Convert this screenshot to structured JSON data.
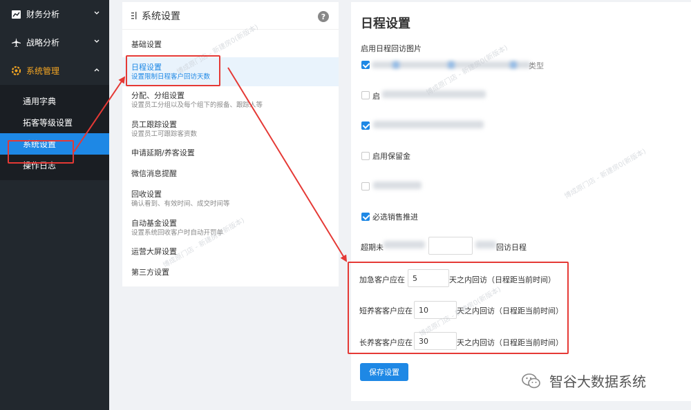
{
  "sidebar": {
    "groups": [
      {
        "label": "财务分析",
        "icon": "chart-icon"
      },
      {
        "label": "战略分析",
        "icon": "plane-icon"
      },
      {
        "label": "系统管理",
        "icon": "settings-icon"
      }
    ],
    "sub_items": [
      {
        "label": "通用字典"
      },
      {
        "label": "拓客等级设置"
      },
      {
        "label": "系统设置"
      },
      {
        "label": "操作日志"
      }
    ],
    "active_sub": "系统设置"
  },
  "mid": {
    "title": "系统设置",
    "items": [
      {
        "title": "基础设置",
        "desc": ""
      },
      {
        "title": "日程设置",
        "desc": "设置限制日程客户回访天数"
      },
      {
        "title": "分配、分组设置",
        "desc": "设置员工分组以及每个组下的报备、跟踪人等"
      },
      {
        "title": "员工跟踪设置",
        "desc": "设置员工可跟踪客资数"
      },
      {
        "title": "申请延期/养客设置",
        "desc": ""
      },
      {
        "title": "微信消息提醒",
        "desc": ""
      },
      {
        "title": "回收设置",
        "desc": "确认看到、有效时间、成交时间等"
      },
      {
        "title": "自动基金设置",
        "desc": "设置系统回收客户时自动开罚单"
      },
      {
        "title": "运营大屏设置",
        "desc": ""
      },
      {
        "title": "第三方设置",
        "desc": ""
      }
    ]
  },
  "right": {
    "title": "日程设置",
    "enable_label": "启用日程回访图片",
    "cb_deposit": "启用保留金",
    "cb_sales": "必选销售推进",
    "overdue_prefix": "超期未",
    "overdue_suffix": "回访日程",
    "partial_texts": {
      "row1_tail": "类型",
      "row2_head": "启"
    },
    "rows": [
      {
        "prefix": "加急客户应在",
        "value": "5",
        "suffix": "天之内回访（日程距当前时间）"
      },
      {
        "prefix": "短养客客户应在",
        "value": "10",
        "suffix": "天之内回访（日程距当前时间）"
      },
      {
        "prefix": "长养客客户应在",
        "value": "30",
        "suffix": "天之内回访（日程距当前时间）"
      }
    ],
    "save_label": "保存设置",
    "watermark": "博成原门店 - 新建房0(新版本)"
  },
  "brand": {
    "text": "智谷大数据系统"
  },
  "colors": {
    "accent": "#1e88e5",
    "annotation": "#e53935",
    "sidebar_bg": "#22282e",
    "active_group": "#f5a623"
  }
}
